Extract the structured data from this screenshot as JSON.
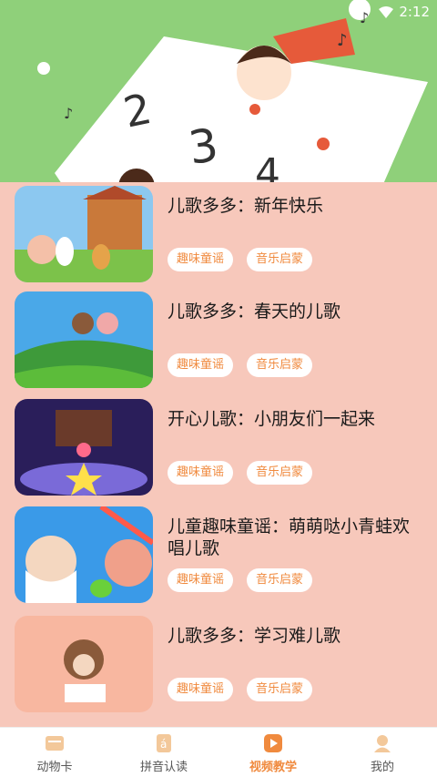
{
  "status": {
    "time": "2:12"
  },
  "videos": [
    {
      "title": "儿歌多多：新年快乐",
      "tags": [
        "趣味童谣",
        "音乐启蒙"
      ]
    },
    {
      "title": "儿歌多多：春天的儿歌",
      "tags": [
        "趣味童谣",
        "音乐启蒙"
      ]
    },
    {
      "title": "开心儿歌：小朋友们一起来",
      "tags": [
        "趣味童谣",
        "音乐启蒙"
      ]
    },
    {
      "title": "儿童趣味童谣：萌萌哒小青蛙欢唱儿歌",
      "tags": [
        "趣味童谣",
        "音乐启蒙"
      ]
    },
    {
      "title": "儿歌多多：学习难儿歌",
      "tags": [
        "趣味童谣",
        "音乐启蒙"
      ]
    }
  ],
  "tabs": [
    {
      "label": "动物卡",
      "icon": "card-icon"
    },
    {
      "label": "拼音认读",
      "icon": "pinyin-icon"
    },
    {
      "label": "视频教学",
      "icon": "video-icon",
      "active": true
    },
    {
      "label": "我的",
      "icon": "user-icon"
    }
  ],
  "colors": {
    "accent": "#f08a3e",
    "list_bg": "#f7c8bb",
    "banner_bg": "#8fd07a"
  }
}
